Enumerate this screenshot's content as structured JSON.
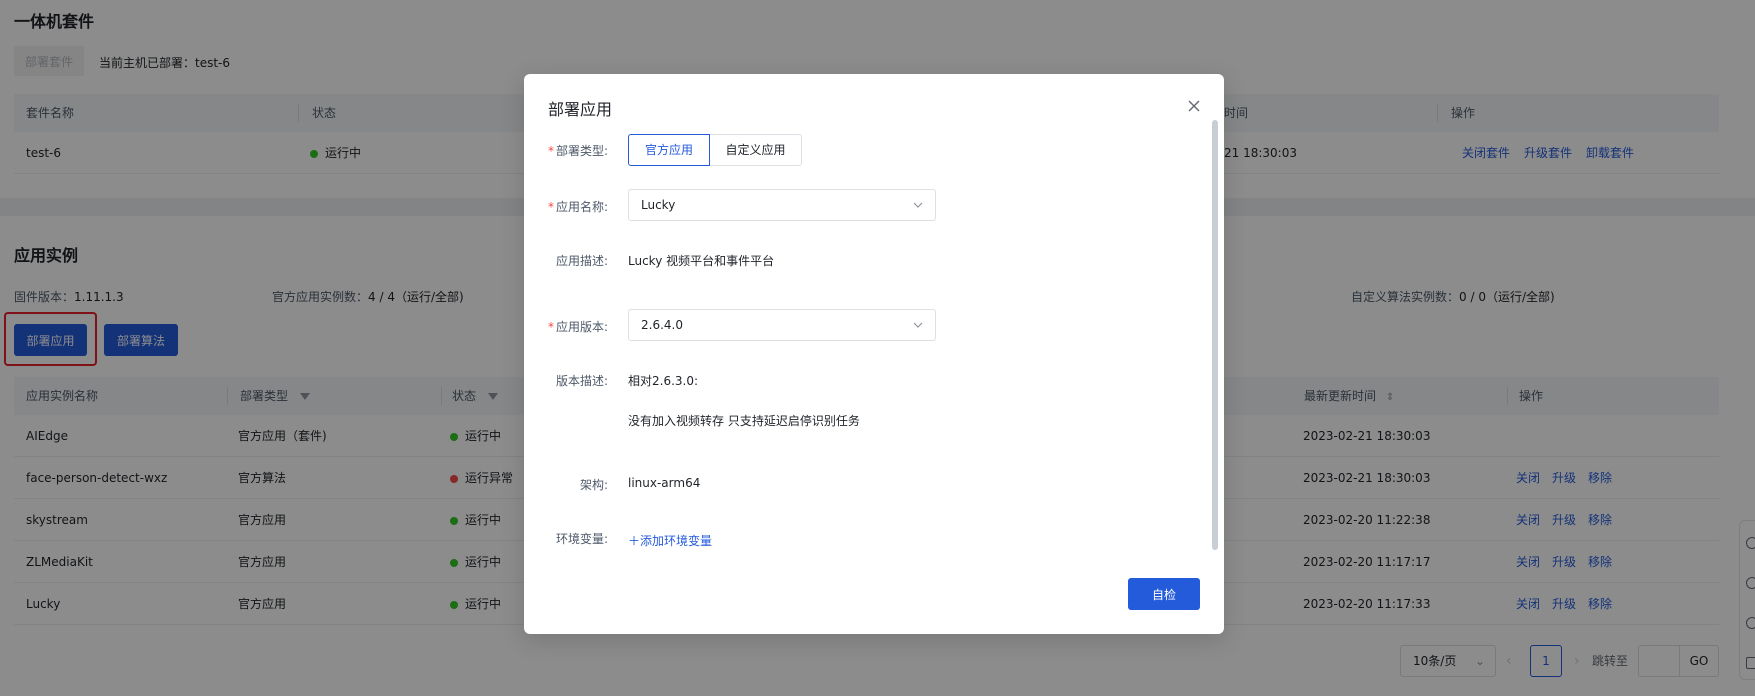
{
  "suite_section": {
    "title": "一体机套件",
    "deploy_suite_button": "部署套件",
    "current_deployed": "当前主机已部署：test-6",
    "columns": [
      "套件名称",
      "状态",
      "时间",
      "操作"
    ],
    "row": {
      "name": "test-6",
      "status": "运行中",
      "time": "21 18:30:03",
      "actions": [
        "关闭套件",
        "升级套件",
        "卸载套件"
      ]
    }
  },
  "instance_section": {
    "title": "应用实例",
    "firmware_label": "固件版本：",
    "firmware_value": "1.11.1.3",
    "official_count_label": "官方应用实例数：",
    "official_count_value": "4 / 4（运行/全部)",
    "custom_count_label": "自定义算法实例数：",
    "custom_count_value": "0 / 0（运行/全部)",
    "deploy_app_button": "部署应用",
    "deploy_algo_button": "部署算法",
    "columns": [
      "应用实例名称",
      "部署类型",
      "状态",
      "最新更新时间",
      "操作"
    ],
    "rows": [
      {
        "name": "AIEdge",
        "type": "官方应用（套件)",
        "status": "运行中",
        "status_color": "#34c724",
        "updated": "2023-02-21 18:30:03",
        "actions": []
      },
      {
        "name": "face-person-detect-wxz",
        "type": "官方算法",
        "status": "运行异常",
        "status_color": "#f54a45",
        "updated": "2023-02-21 18:30:03",
        "actions": [
          "关闭",
          "升级",
          "移除"
        ]
      },
      {
        "name": "skystream",
        "type": "官方应用",
        "status": "运行中",
        "status_color": "#34c724",
        "updated": "2023-02-20 11:22:38",
        "actions": [
          "关闭",
          "升级",
          "移除"
        ]
      },
      {
        "name": "ZLMediaKit",
        "type": "官方应用",
        "status": "运行中",
        "status_color": "#34c724",
        "updated": "2023-02-20 11:17:17",
        "actions": [
          "关闭",
          "升级",
          "移除"
        ]
      },
      {
        "name": "Lucky",
        "type": "官方应用",
        "status": "运行中",
        "status_color": "#34c724",
        "updated": "2023-02-20 11:17:33",
        "actions": [
          "关闭",
          "升级",
          "移除"
        ]
      }
    ],
    "pagination": {
      "page_size": "10条/页",
      "current_page": "1",
      "jump_label": "跳转至",
      "go_label": "GO"
    }
  },
  "modal": {
    "title": "部署应用",
    "deploy_type_label": "部署类型:",
    "deploy_type_options": [
      "官方应用",
      "自定义应用"
    ],
    "deploy_type_selected": "官方应用",
    "app_name_label": "应用名称:",
    "app_name_value": "Lucky",
    "app_desc_label": "应用描述:",
    "app_desc_value": "Lucky 视频平台和事件平台",
    "app_version_label": "应用版本:",
    "app_version_value": "2.6.4.0",
    "version_desc_label": "版本描述:",
    "version_desc_line1": "相对2.6.3.0:",
    "version_desc_line2": "没有加入视频转存 只支持延迟启停识别任务",
    "arch_label": "架构:",
    "arch_value": "linux-arm64",
    "env_label": "环境变量:",
    "add_env_label": "添加环境变量",
    "check_button": "自检"
  },
  "colors": {
    "primary": "#245bdb",
    "running": "#34c724",
    "error": "#f54a45",
    "highlight": "#e8202c"
  }
}
